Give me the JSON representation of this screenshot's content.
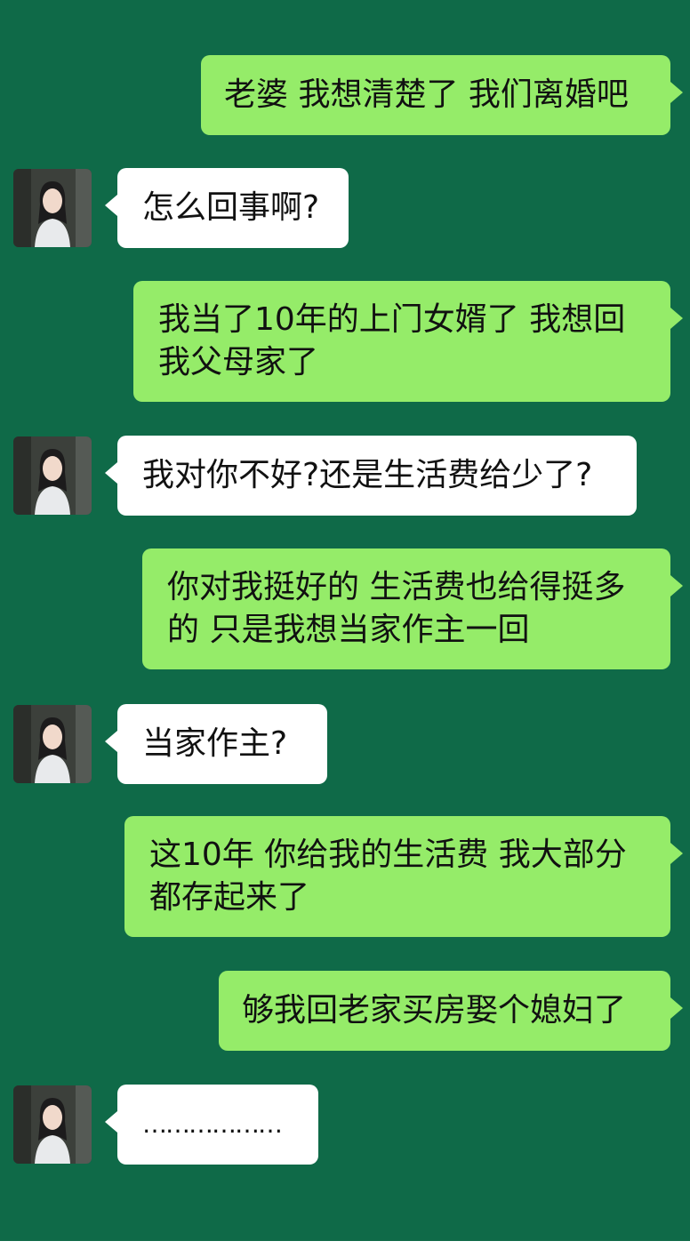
{
  "chat": {
    "messages": [
      {
        "side": "right",
        "text": "老婆 我想清楚了 我们离婚吧"
      },
      {
        "side": "left",
        "text": "怎么回事啊?"
      },
      {
        "side": "right",
        "text": "我当了10年的上门女婿了 我想回\n我父母家了"
      },
      {
        "side": "left",
        "text": "我对你不好?还是生活费给少了?"
      },
      {
        "side": "right",
        "text": "你对我挺好的 生活费也给得挺多\n的 只是我想当家作主一回"
      },
      {
        "side": "left",
        "text": "当家作主?"
      },
      {
        "side": "right",
        "text": "这10年 你给我的生活费 我大部分\n都存起来了"
      },
      {
        "side": "right",
        "text": "够我回老家买房娶个媳妇了"
      },
      {
        "side": "left",
        "text": "………………"
      }
    ]
  },
  "colors": {
    "background": "#0f6a48",
    "sent_bubble": "#95ec69",
    "received_bubble": "#ffffff"
  },
  "icons": {
    "avatar": "contact-avatar-photo"
  }
}
